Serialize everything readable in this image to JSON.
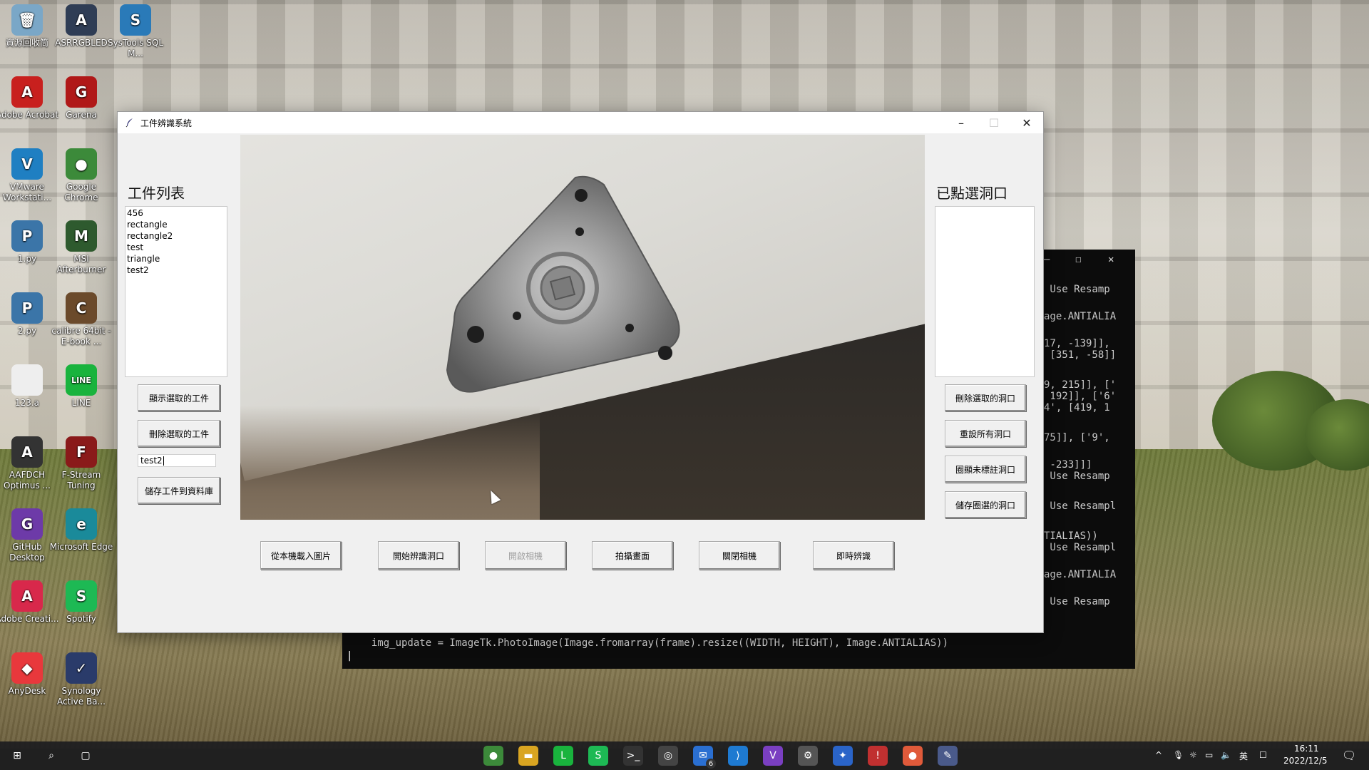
{
  "desktop": {
    "icons": [
      {
        "label": "資源回收筒",
        "color": "#7aa7c7",
        "glyph": "🗑"
      },
      {
        "label": "ASRRGBLED",
        "color": "#2f3d55",
        "glyph": "A"
      },
      {
        "label": "SysTools SQL M...",
        "color": "#2a7ab8",
        "glyph": "S"
      },
      {
        "label": "Adobe Acrobat",
        "color": "#c8201e",
        "glyph": "A"
      },
      {
        "label": "Garena",
        "color": "#b01818",
        "glyph": "G"
      },
      {
        "label": "VMware Workstati...",
        "color": "#1f7fc2",
        "glyph": "V"
      },
      {
        "label": "Google Chrome",
        "color": "#3c8a3a",
        "glyph": "●"
      },
      {
        "label": "1.py",
        "color": "#3b75a8",
        "glyph": "P"
      },
      {
        "label": "MSI Afterburner",
        "color": "#2e5a2e",
        "glyph": "M"
      },
      {
        "label": "2.py",
        "color": "#3b75a8",
        "glyph": "P"
      },
      {
        "label": "calibre 64bit - E-book ...",
        "color": "#6b4a2b",
        "glyph": "C"
      },
      {
        "label": "123.a",
        "color": "#eeeeee",
        "glyph": ""
      },
      {
        "label": "LINE",
        "color": "#19b33d",
        "glyph": "LINE"
      },
      {
        "label": "AAFDCH Optimus ...",
        "color": "#333333",
        "glyph": "A"
      },
      {
        "label": "F-Stream Tuning",
        "color": "#8a1a1a",
        "glyph": "F"
      },
      {
        "label": "GitHub Desktop",
        "color": "#6d3aa8",
        "glyph": "G"
      },
      {
        "label": "Microsoft Edge",
        "color": "#1a8a9a",
        "glyph": "e"
      },
      {
        "label": "Adobe Creati...",
        "color": "#d8284b",
        "glyph": "A"
      },
      {
        "label": "Spotify",
        "color": "#1db954",
        "glyph": "S"
      },
      {
        "label": "AnyDesk",
        "color": "#e8383c",
        "glyph": "◆"
      },
      {
        "label": "Synology Active Ba...",
        "color": "#2a3b6a",
        "glyph": "✓"
      }
    ]
  },
  "window": {
    "title": "工件辨識系統",
    "minimize": "–",
    "maximize": "☐",
    "close": "✕"
  },
  "left_panel": {
    "heading": "工件列表",
    "items": [
      "456",
      "rectangle",
      "rectangle2",
      "test",
      "triangle",
      "test2"
    ],
    "show_button": "顯示選取的工件",
    "delete_button": "刪除選取的工件",
    "name_entry": "test2",
    "save_button": "儲存工件到資料庫"
  },
  "right_panel": {
    "heading": "已點選洞口",
    "items": [],
    "delete_button": "刪除選取的洞口",
    "reset_button": "重設所有洞口",
    "circle_button": "圈顯未標註洞口",
    "save_button": "儲存圈選的洞口"
  },
  "bottom_buttons": {
    "load_from_robot": "從本機載入圖片",
    "start_detect": "開始辨識洞口",
    "open_camera": "開啟相機",
    "capture": "拍攝畫面",
    "close_camera": "關閉相機",
    "realtime": "即時辨識"
  },
  "terminal": {
    "lines": [
      " Use Resamp",
      "age.ANTIALIA",
      "17, -139]],",
      " [351, -58]]",
      "9, 215]], ['",
      " 192]], ['6'",
      "4', [419, 1",
      "75]], ['9',",
      " -233]]]",
      " Use Resamp",
      " Use Resampl",
      "TIALIAS))",
      " Use Resampl",
      "age.ANTIALIA",
      " Use Resamp"
    ],
    "code_line": "  img_update = ImageTk.PhotoImage(Image.fromarray(frame).resize((WIDTH, HEIGHT), Image.ANTIALIAS))",
    "prompt": "|"
  },
  "taskbar": {
    "time": "16:11",
    "date": "2022/12/5",
    "ime": "英",
    "mail_badge": "6",
    "apps": [
      {
        "name": "chrome",
        "color": "#3c8a3a",
        "glyph": "●"
      },
      {
        "name": "explorer",
        "color": "#d9a521",
        "glyph": "▬"
      },
      {
        "name": "line",
        "color": "#19b33d",
        "glyph": "L"
      },
      {
        "name": "spotify",
        "color": "#1db954",
        "glyph": "S"
      },
      {
        "name": "terminal",
        "color": "#333333",
        "glyph": ">_"
      },
      {
        "name": "chatgpt",
        "color": "#444444",
        "glyph": "◎"
      },
      {
        "name": "mail",
        "color": "#2a6fd1",
        "glyph": "✉"
      },
      {
        "name": "vscode",
        "color": "#1e7ad1",
        "glyph": "⟩"
      },
      {
        "name": "visual-studio",
        "color": "#7a3fc1",
        "glyph": "V"
      },
      {
        "name": "settings",
        "color": "#555555",
        "glyph": "⚙"
      },
      {
        "name": "bluetooth-app",
        "color": "#2a64c8",
        "glyph": "✦"
      },
      {
        "name": "pin-app",
        "color": "#c03030",
        "glyph": "!"
      },
      {
        "name": "color-app",
        "color": "#e05a3a",
        "glyph": "●"
      },
      {
        "name": "python-feather",
        "color": "#4a5a8a",
        "glyph": "✎"
      }
    ]
  }
}
